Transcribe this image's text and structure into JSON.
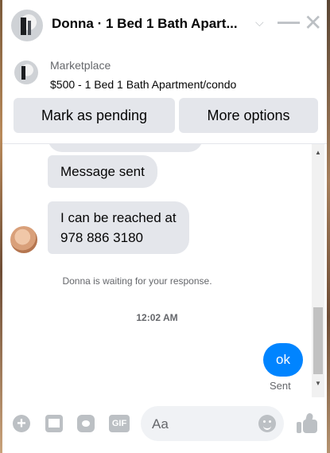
{
  "header": {
    "title": "Donna · 1 Bed 1 Bath Apart...",
    "chevron_icon": "chevron-down-icon",
    "minimize_icon": "minimize-icon",
    "close_icon": "close-icon"
  },
  "marketplace": {
    "label": "Marketplace",
    "listing": "$500 - 1 Bed 1 Bath Apartment/condo",
    "buttons": {
      "pending": "Mark as pending",
      "more": "More options"
    }
  },
  "thread": {
    "messages": [
      {
        "from": "other",
        "text": "Message sent"
      },
      {
        "from": "other",
        "lines": [
          "I can be reached at",
          "978 886 3180"
        ]
      }
    ],
    "system_notice": "Donna is waiting for your response.",
    "timestamp": "12:02 AM",
    "my_message": "ok",
    "status": "Sent"
  },
  "composer": {
    "placeholder": "Aa",
    "gif_label": "GIF"
  },
  "colors": {
    "accent": "#0084ff",
    "bubble_gray": "#e4e6eb",
    "icon_gray": "#bcc0c4"
  }
}
